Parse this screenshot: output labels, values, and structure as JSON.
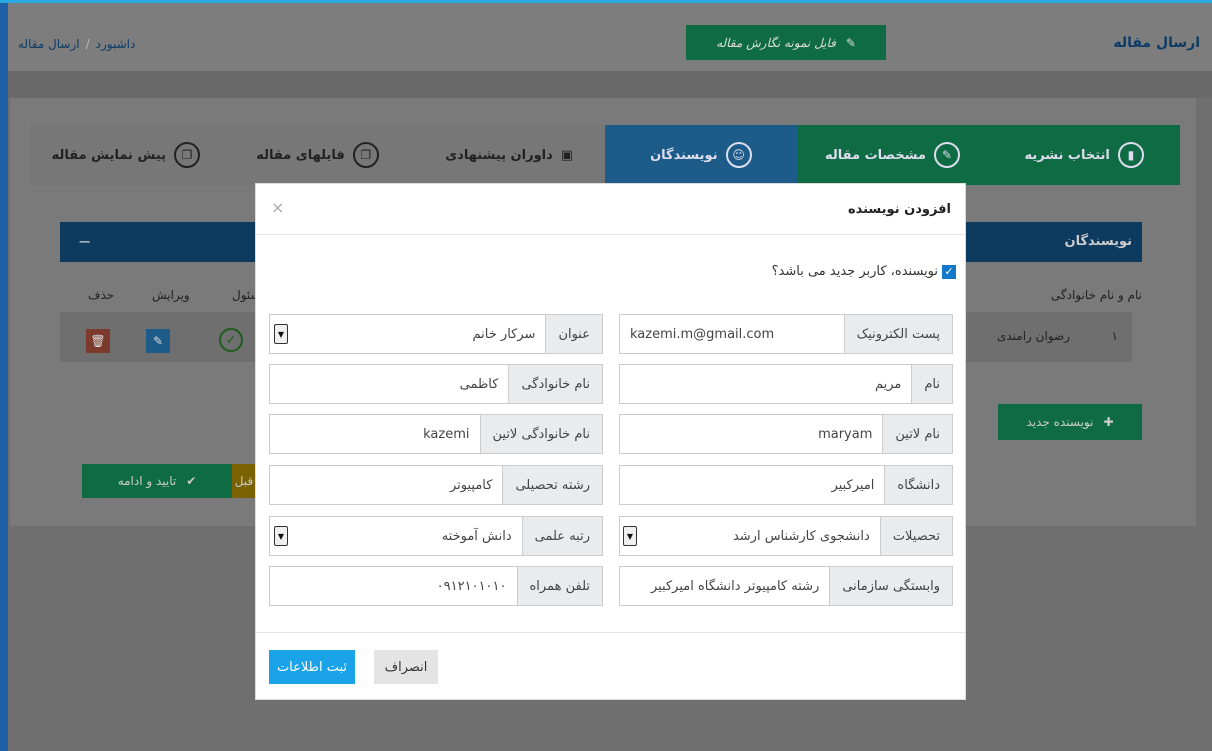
{
  "header": {
    "page_title": "ارسال مقاله",
    "breadcrumb_dashboard": "داشبورد",
    "breadcrumb_separator": "/",
    "breadcrumb_current": "ارسال مقاله",
    "template_button": "فایل نمونه نگارش مقاله"
  },
  "steps": [
    {
      "label": "انتخاب نشریه"
    },
    {
      "label": "مشخصات مقاله"
    },
    {
      "label": "نویسندگان"
    },
    {
      "label": "داوران پیشنهادی"
    },
    {
      "label": "فایلهای مقاله"
    },
    {
      "label": "پیش نمایش مقاله"
    }
  ],
  "authors_panel": {
    "title": "نویسندگان",
    "collapse_symbol": "−",
    "columns": {
      "name": "نام و نام خانوادگی",
      "responsible": "مسئول",
      "edit": "ویرایش",
      "delete": "حذف"
    },
    "rows": [
      {
        "index": "۱",
        "name": "رضوان رامندی"
      }
    ],
    "new_author_button": "نویسنده جدید",
    "confirm_button": "تایید و ادامه",
    "prev_button": "قبل"
  },
  "modal": {
    "title": "افزودن نویسنده",
    "close": "×",
    "new_user_label": "نویسنده، کاربر جدید می باشد؟",
    "fields": {
      "email": {
        "label": "پست الکترونیک",
        "value": "kazemi.m@gmail.com"
      },
      "title": {
        "label": "عنوان",
        "value": "سرکار خانم"
      },
      "first_name": {
        "label": "نام",
        "value": "مریم"
      },
      "last_name": {
        "label": "نام خانوادگی",
        "value": "کاظمی"
      },
      "latin_first_name": {
        "label": "نام لاتین",
        "value": "maryam"
      },
      "latin_last_name": {
        "label": "نام خانوادگی لاتین",
        "value": "kazemi"
      },
      "university": {
        "label": "دانشگاه",
        "value": "امیرکبیر"
      },
      "field_of_study": {
        "label": "رشته تحصیلی",
        "value": "کامپیوتر"
      },
      "education": {
        "label": "تحصیلات",
        "value": "دانشجوی کارشناس ارشد"
      },
      "academic_rank": {
        "label": "رتبه علمی",
        "value": "دانش آموخته"
      },
      "affiliation": {
        "label": "وابستگی سازمانی",
        "value": "رشته کامپیوتر دانشگاه امیرکبیر"
      },
      "mobile": {
        "label": "تلفن همراه",
        "value": "۰۹۱۲۱۰۱۰۱۰"
      }
    },
    "save_button": "ثبت اطلاعات",
    "cancel_button": "انصراف"
  }
}
